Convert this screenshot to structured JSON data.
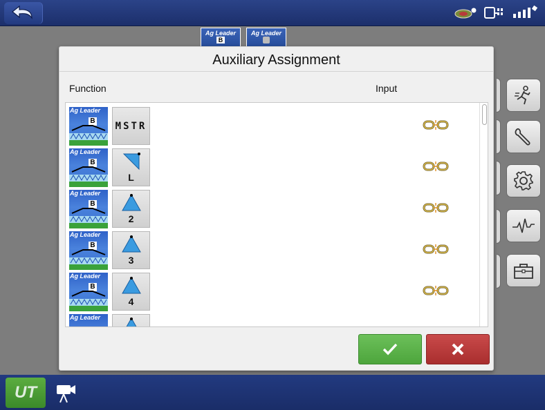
{
  "top_tabs": [
    {
      "brand": "Ag Leader",
      "badge": "B"
    },
    {
      "brand": "Ag Leader",
      "badge": ""
    }
  ],
  "dialog": {
    "title": "Auxiliary Assignment",
    "col_function": "Function",
    "col_input": "Input"
  },
  "rows": [
    {
      "brand": "Ag Leader",
      "badge": "B",
      "function_label": "MSTR",
      "function_num": "",
      "icon": "master-switch-icon"
    },
    {
      "brand": "Ag Leader",
      "badge": "B",
      "function_label": "",
      "function_num": "L",
      "icon": "boom-section-left-icon"
    },
    {
      "brand": "Ag Leader",
      "badge": "B",
      "function_label": "",
      "function_num": "2",
      "icon": "boom-section-icon"
    },
    {
      "brand": "Ag Leader",
      "badge": "B",
      "function_label": "",
      "function_num": "3",
      "icon": "boom-section-icon"
    },
    {
      "brand": "Ag Leader",
      "badge": "B",
      "function_label": "",
      "function_num": "4",
      "icon": "boom-section-icon"
    },
    {
      "brand": "Ag Leader",
      "badge": "",
      "function_label": "",
      "function_num": "",
      "icon": "boom-section-icon"
    }
  ],
  "bottom": {
    "ut_label": "UT"
  },
  "colors": {
    "ok": "#5cb34a",
    "cancel": "#b53a3a",
    "bar": "#223a80",
    "ut": "#4c9b35"
  }
}
